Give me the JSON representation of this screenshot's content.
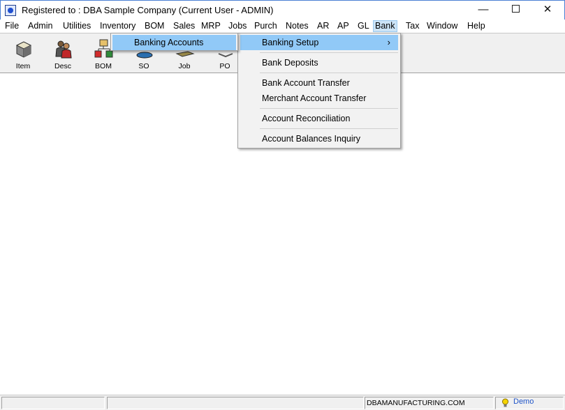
{
  "window": {
    "title": "Registered to : DBA Sample Company (Current User - ADMIN)",
    "minimize_glyph": "—",
    "close_glyph": "✕"
  },
  "menubar": {
    "items": [
      "File",
      "Admin",
      "Utilities",
      "Inventory",
      "BOM",
      "Sales",
      "MRP",
      "Jobs",
      "Purch",
      "Notes",
      "AR",
      "AP",
      "GL",
      "Bank",
      "Tax",
      "Window",
      "Help"
    ],
    "active": "Bank"
  },
  "toolbar": {
    "buttons": [
      {
        "label": "Item",
        "icon": "item-box-icon"
      },
      {
        "label": "Desc",
        "icon": "desc-people-icon"
      },
      {
        "label": "BOM",
        "icon": "bom-structure-icon"
      },
      {
        "label": "SO",
        "icon": "sales-order-icon"
      },
      {
        "label": "Job",
        "icon": "job-icon"
      },
      {
        "label": "PO",
        "icon": "purchase-order-icon"
      }
    ]
  },
  "bank_menu": {
    "items": [
      {
        "label": "Banking Setup",
        "submenu_arrow": "›",
        "highlighted": true
      },
      {
        "label": "Bank Deposits"
      },
      {
        "label": "Bank Account Transfer"
      },
      {
        "label": "Merchant Account Transfer"
      },
      {
        "label": "Account Reconciliation"
      },
      {
        "label": "Account Balances Inquiry"
      }
    ]
  },
  "banking_setup_submenu": {
    "items": [
      {
        "label": "Banking Accounts",
        "highlighted": true
      }
    ]
  },
  "statusbar": {
    "website": "DBAMANUFACTURING.COM",
    "mode": "Demo",
    "bulb_icon": "lightbulb-icon",
    "colors": {
      "mode_text": "#1f54c8",
      "menu_highlight": "#91c9f7"
    }
  }
}
